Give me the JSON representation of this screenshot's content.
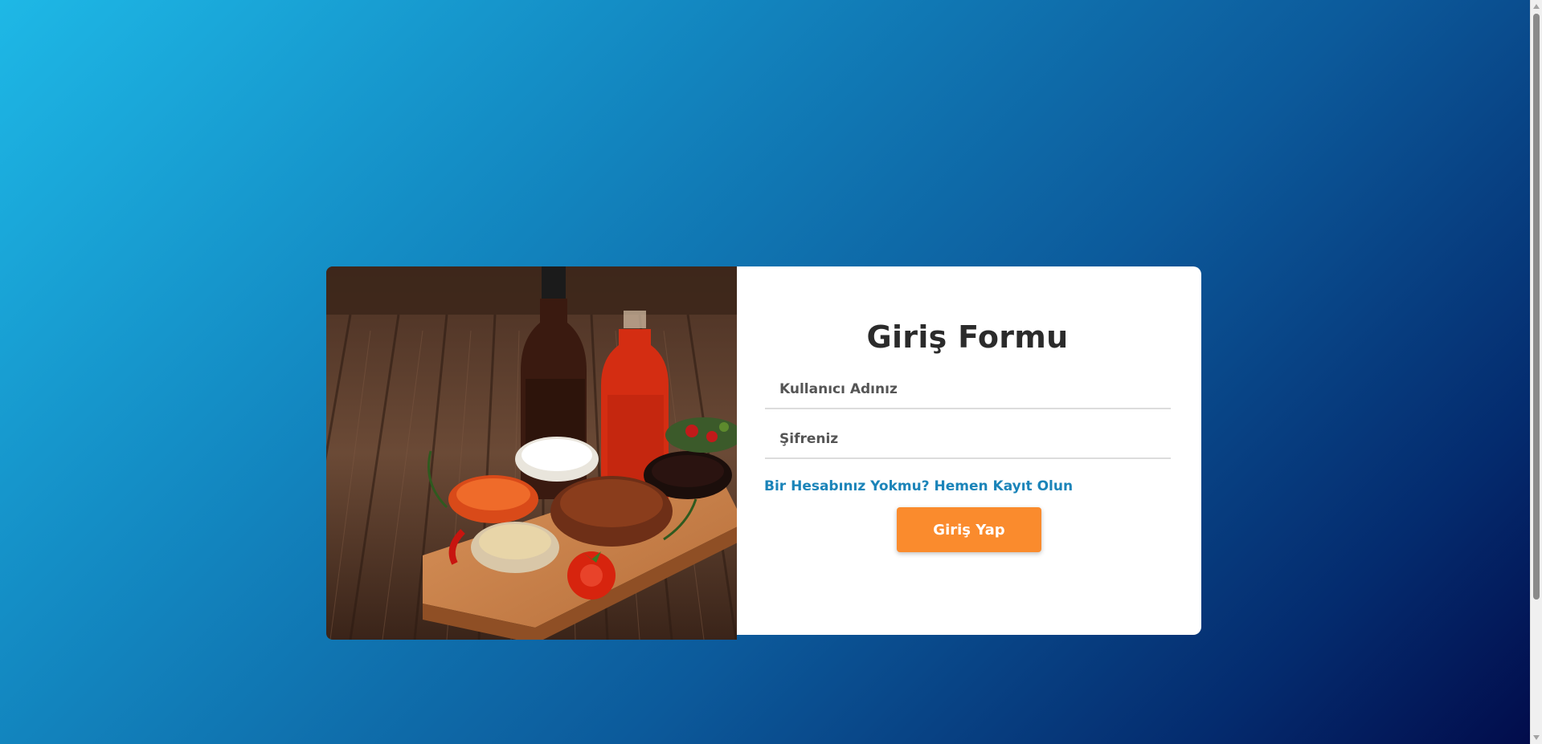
{
  "login_form": {
    "title": "Giriş Formu",
    "username_placeholder": "Kullanıcı Adınız",
    "password_placeholder": "Şifreniz",
    "register_link": "Bir Hesabınız Yokmu? Hemen Kayıt Olun",
    "submit_label": "Giriş Yap"
  },
  "colors": {
    "background_start": "#1eb8e6",
    "background_end": "#020b4a",
    "accent_button": "#fa8b2d",
    "link": "#1b84b9",
    "title": "#2b2b2b"
  }
}
